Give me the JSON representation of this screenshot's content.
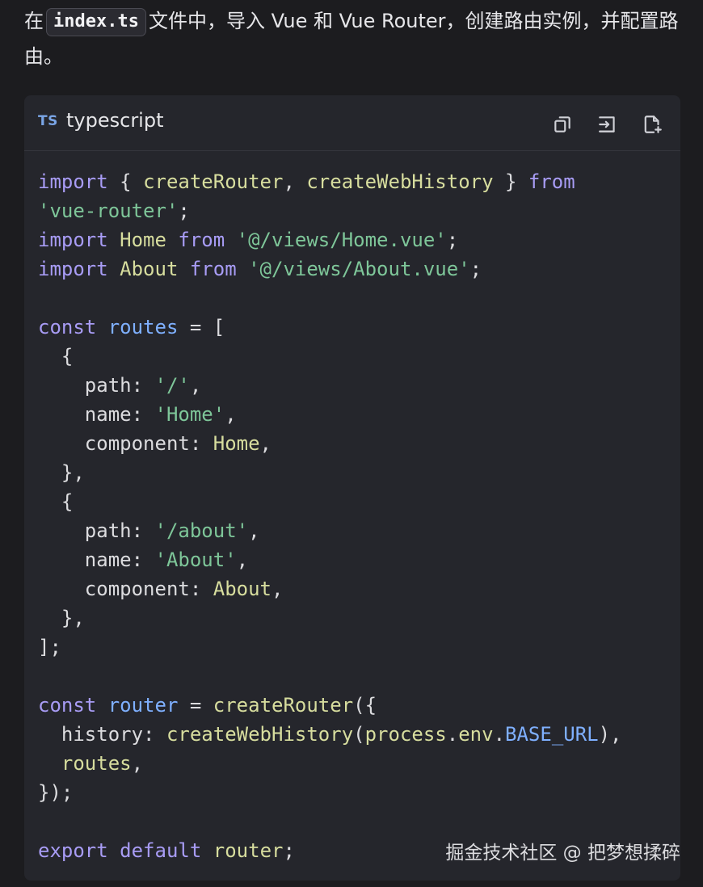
{
  "intro": {
    "before": "在",
    "file_name": "index.ts",
    "after": "文件中，导入 Vue 和 Vue Router，创建路由实例，并配置路由。"
  },
  "code_block": {
    "lang_badge": "TS",
    "language": "typescript",
    "toolbar": {
      "copy_icon": "copy-icon",
      "insert_icon": "insert-code-icon",
      "new_file_icon": "new-file-icon"
    },
    "lines": [
      [
        {
          "t": "import",
          "c": "kw"
        },
        {
          "t": " { ",
          "c": "pn"
        },
        {
          "t": "createRouter",
          "c": "id"
        },
        {
          "t": ", ",
          "c": "pn"
        },
        {
          "t": "createWebHistory",
          "c": "id"
        },
        {
          "t": " } ",
          "c": "pn"
        },
        {
          "t": "from",
          "c": "kw"
        }
      ],
      [
        {
          "t": "'vue-router'",
          "c": "str"
        },
        {
          "t": ";",
          "c": "pn"
        }
      ],
      [
        {
          "t": "import",
          "c": "kw"
        },
        {
          "t": " ",
          "c": "pn"
        },
        {
          "t": "Home",
          "c": "id"
        },
        {
          "t": " ",
          "c": "pn"
        },
        {
          "t": "from",
          "c": "kw"
        },
        {
          "t": " ",
          "c": "pn"
        },
        {
          "t": "'@/views/Home.vue'",
          "c": "str"
        },
        {
          "t": ";",
          "c": "pn"
        }
      ],
      [
        {
          "t": "import",
          "c": "kw"
        },
        {
          "t": " ",
          "c": "pn"
        },
        {
          "t": "About",
          "c": "id"
        },
        {
          "t": " ",
          "c": "pn"
        },
        {
          "t": "from",
          "c": "kw"
        },
        {
          "t": " ",
          "c": "pn"
        },
        {
          "t": "'@/views/About.vue'",
          "c": "str"
        },
        {
          "t": ";",
          "c": "pn"
        }
      ],
      [],
      [
        {
          "t": "const",
          "c": "kw"
        },
        {
          "t": " ",
          "c": "pn"
        },
        {
          "t": "routes",
          "c": "var"
        },
        {
          "t": " = [",
          "c": "pn"
        }
      ],
      [
        {
          "t": "  {",
          "c": "pn"
        }
      ],
      [
        {
          "t": "    path",
          "c": "prop"
        },
        {
          "t": ": ",
          "c": "pn"
        },
        {
          "t": "'/'",
          "c": "str"
        },
        {
          "t": ",",
          "c": "pn"
        }
      ],
      [
        {
          "t": "    name",
          "c": "prop"
        },
        {
          "t": ": ",
          "c": "pn"
        },
        {
          "t": "'Home'",
          "c": "str"
        },
        {
          "t": ",",
          "c": "pn"
        }
      ],
      [
        {
          "t": "    component",
          "c": "prop"
        },
        {
          "t": ": ",
          "c": "pn"
        },
        {
          "t": "Home",
          "c": "id"
        },
        {
          "t": ",",
          "c": "pn"
        }
      ],
      [
        {
          "t": "  },",
          "c": "pn"
        }
      ],
      [
        {
          "t": "  {",
          "c": "pn"
        }
      ],
      [
        {
          "t": "    path",
          "c": "prop"
        },
        {
          "t": ": ",
          "c": "pn"
        },
        {
          "t": "'/about'",
          "c": "str"
        },
        {
          "t": ",",
          "c": "pn"
        }
      ],
      [
        {
          "t": "    name",
          "c": "prop"
        },
        {
          "t": ": ",
          "c": "pn"
        },
        {
          "t": "'About'",
          "c": "str"
        },
        {
          "t": ",",
          "c": "pn"
        }
      ],
      [
        {
          "t": "    component",
          "c": "prop"
        },
        {
          "t": ": ",
          "c": "pn"
        },
        {
          "t": "About",
          "c": "id"
        },
        {
          "t": ",",
          "c": "pn"
        }
      ],
      [
        {
          "t": "  },",
          "c": "pn"
        }
      ],
      [
        {
          "t": "];",
          "c": "pn"
        }
      ],
      [],
      [
        {
          "t": "const",
          "c": "kw"
        },
        {
          "t": " ",
          "c": "pn"
        },
        {
          "t": "router",
          "c": "var"
        },
        {
          "t": " = ",
          "c": "pn"
        },
        {
          "t": "createRouter",
          "c": "id"
        },
        {
          "t": "({",
          "c": "pn"
        }
      ],
      [
        {
          "t": "  history",
          "c": "prop"
        },
        {
          "t": ": ",
          "c": "pn"
        },
        {
          "t": "createWebHistory",
          "c": "id"
        },
        {
          "t": "(",
          "c": "pn"
        },
        {
          "t": "process",
          "c": "id"
        },
        {
          "t": ".",
          "c": "pn"
        },
        {
          "t": "env",
          "c": "id"
        },
        {
          "t": ".",
          "c": "pn"
        },
        {
          "t": "BASE_URL",
          "c": "var"
        },
        {
          "t": "),",
          "c": "pn"
        }
      ],
      [
        {
          "t": "  routes",
          "c": "id"
        },
        {
          "t": ",",
          "c": "pn"
        }
      ],
      [
        {
          "t": "});",
          "c": "pn"
        }
      ],
      [],
      [
        {
          "t": "export",
          "c": "kw"
        },
        {
          "t": " ",
          "c": "pn"
        },
        {
          "t": "default",
          "c": "kw"
        },
        {
          "t": " ",
          "c": "pn"
        },
        {
          "t": "router",
          "c": "id"
        },
        {
          "t": ";",
          "c": "pn"
        }
      ]
    ],
    "watermark": "掘金技术社区 @ 把梦想揉碎"
  }
}
